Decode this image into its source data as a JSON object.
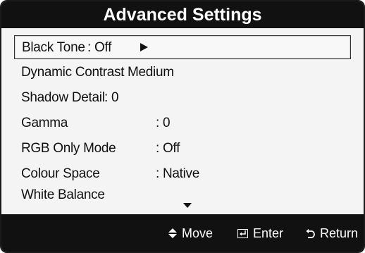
{
  "window": {
    "title": "Advanced Settings"
  },
  "menu": {
    "items": [
      {
        "label": "Black Tone",
        "value": ": Off",
        "selected": true
      },
      {
        "label": "Dynamic Contrast",
        "value": ": Medium"
      },
      {
        "label": "Shadow Detail",
        "value": ": 0"
      },
      {
        "label": "Gamma",
        "value": ": 0"
      },
      {
        "label": "RGB Only Mode",
        "value": ": Off"
      },
      {
        "label": "Colour Space",
        "value": ": Native"
      },
      {
        "label": "White Balance",
        "value": ""
      }
    ]
  },
  "footer": {
    "move_label": "Move",
    "enter_label": "Enter",
    "return_label": "Return"
  },
  "icons": {
    "submenu": "arrow-right-icon",
    "more": "scroll-down-icon",
    "move": "up-down-arrows-icon",
    "enter": "enter-key-icon",
    "return": "return-arrow-icon"
  },
  "colors": {
    "bar_background": "#111111",
    "menu_background": "#f4f4f4",
    "text": "#111111"
  }
}
